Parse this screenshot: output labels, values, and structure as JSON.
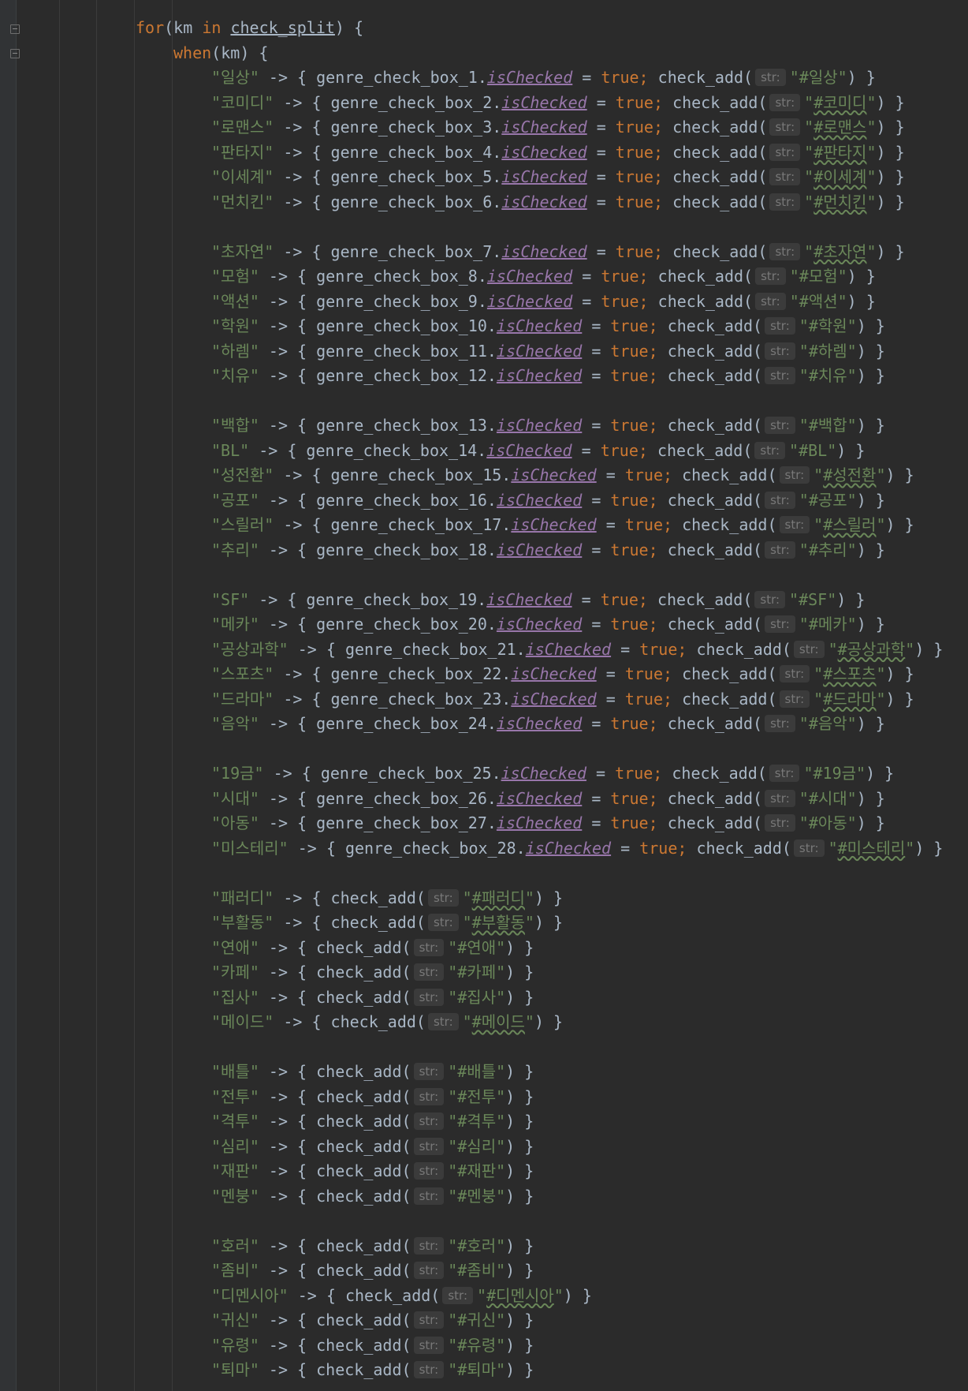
{
  "code": {
    "for_kw": "for",
    "in_kw": "in",
    "loop_var": "km",
    "collection": "check_split",
    "when_kw": "when",
    "param_hint": "str:",
    "cases": [
      {
        "key": "\"일상\"",
        "box": "genre_check_box_1",
        "tag": "#일상"
      },
      {
        "key": "\"코미디\"",
        "box": "genre_check_box_2",
        "tag": "#코미디"
      },
      {
        "key": "\"로맨스\"",
        "box": "genre_check_box_3",
        "tag": "#로맨스"
      },
      {
        "key": "\"판타지\"",
        "box": "genre_check_box_4",
        "tag": "#판타지"
      },
      {
        "key": "\"이세계\"",
        "box": "genre_check_box_5",
        "tag": "#이세계"
      },
      {
        "key": "\"먼치킨\"",
        "box": "genre_check_box_6",
        "tag": "#먼치킨"
      },
      {
        "blank": true
      },
      {
        "key": "\"초자연\"",
        "box": "genre_check_box_7",
        "tag": "#초자연"
      },
      {
        "key": "\"모험\"",
        "box": "genre_check_box_8",
        "tag": "#모험"
      },
      {
        "key": "\"액션\"",
        "box": "genre_check_box_9",
        "tag": "#액션"
      },
      {
        "key": "\"학원\"",
        "box": "genre_check_box_10",
        "tag": "#학원"
      },
      {
        "key": "\"하렘\"",
        "box": "genre_check_box_11",
        "tag": "#하렘"
      },
      {
        "key": "\"치유\"",
        "box": "genre_check_box_12",
        "tag": "#치유"
      },
      {
        "blank": true
      },
      {
        "key": "\"백합\"",
        "box": "genre_check_box_13",
        "tag": "#백합"
      },
      {
        "key": "\"BL\"",
        "box": "genre_check_box_14",
        "tag": "#BL"
      },
      {
        "key": "\"성전환\"",
        "box": "genre_check_box_15",
        "tag": "#성전환"
      },
      {
        "key": "\"공포\"",
        "box": "genre_check_box_16",
        "tag": "#공포"
      },
      {
        "key": "\"스릴러\"",
        "box": "genre_check_box_17",
        "tag": "#스릴러"
      },
      {
        "key": "\"추리\"",
        "box": "genre_check_box_18",
        "tag": "#추리"
      },
      {
        "blank": true
      },
      {
        "key": "\"SF\"",
        "box": "genre_check_box_19",
        "tag": "#SF"
      },
      {
        "key": "\"메카\"",
        "box": "genre_check_box_20",
        "tag": "#메카"
      },
      {
        "key": "\"공상과학\"",
        "box": "genre_check_box_21",
        "tag": "#공상과학"
      },
      {
        "key": "\"스포츠\"",
        "box": "genre_check_box_22",
        "tag": "#스포츠"
      },
      {
        "key": "\"드라마\"",
        "box": "genre_check_box_23",
        "tag": "#드라마"
      },
      {
        "key": "\"음악\"",
        "box": "genre_check_box_24",
        "tag": "#음악"
      },
      {
        "blank": true
      },
      {
        "key": "\"19금\"",
        "box": "genre_check_box_25",
        "tag": "#19금"
      },
      {
        "key": "\"시대\"",
        "box": "genre_check_box_26",
        "tag": "#시대"
      },
      {
        "key": "\"아동\"",
        "box": "genre_check_box_27",
        "tag": "#아동"
      },
      {
        "key": "\"미스테리\"",
        "box": "genre_check_box_28",
        "tag": "#미스테리"
      },
      {
        "blank": true
      },
      {
        "key": "\"패러디\"",
        "tag": "#패러디"
      },
      {
        "key": "\"부활동\"",
        "tag": "#부활동"
      },
      {
        "key": "\"연애\"",
        "tag": "#연애"
      },
      {
        "key": "\"카페\"",
        "tag": "#카페"
      },
      {
        "key": "\"집사\"",
        "tag": "#집사"
      },
      {
        "key": "\"메이드\"",
        "tag": "#메이드"
      },
      {
        "blank": true
      },
      {
        "key": "\"배틀\"",
        "tag": "#배틀"
      },
      {
        "key": "\"전투\"",
        "tag": "#전투"
      },
      {
        "key": "\"격투\"",
        "tag": "#격투"
      },
      {
        "key": "\"심리\"",
        "tag": "#심리"
      },
      {
        "key": "\"재판\"",
        "tag": "#재판"
      },
      {
        "key": "\"멘붕\"",
        "tag": "#멘붕"
      },
      {
        "blank": true
      },
      {
        "key": "\"호러\"",
        "tag": "#호러"
      },
      {
        "key": "\"좀비\"",
        "tag": "#좀비"
      },
      {
        "key": "\"디멘시아\"",
        "tag": "#디멘시아"
      },
      {
        "key": "\"귀신\"",
        "tag": "#귀신"
      },
      {
        "key": "\"유령\"",
        "tag": "#유령"
      },
      {
        "key": "\"퇴마\"",
        "tag": "#퇴마"
      }
    ],
    "tokens": {
      "arrow": "->",
      "is_checked": "isChecked",
      "true_kw": "true",
      "fn": "check_add"
    }
  },
  "colors": {
    "background": "#2b2b2b",
    "text": "#a9b7c6",
    "keyword": "#cc7832",
    "string": "#6a8759",
    "field": "#9876aa"
  }
}
